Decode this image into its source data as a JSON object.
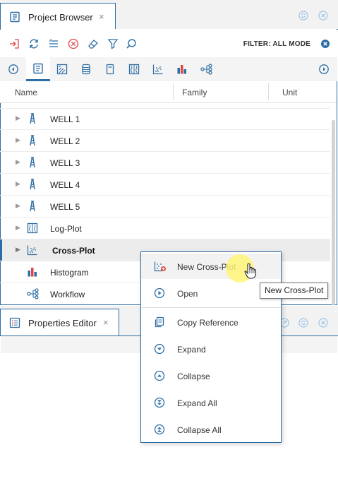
{
  "colors": {
    "accent": "#2d6da3",
    "danger": "#e04646"
  },
  "project_browser": {
    "tab_title": "Project Browser",
    "tab_close": "×",
    "filter_label": "FILTER: ALL MODE",
    "columns": [
      "Name",
      "Family",
      "Unit"
    ],
    "tree_items": [
      {
        "label": "WELL 1",
        "icon": "well-icon"
      },
      {
        "label": "WELL 2",
        "icon": "well-icon"
      },
      {
        "label": "WELL 3",
        "icon": "well-icon"
      },
      {
        "label": "WELL 4",
        "icon": "well-icon"
      },
      {
        "label": "WELL 5",
        "icon": "well-icon"
      },
      {
        "label": "Log-Plot",
        "icon": "log-plot-icon"
      },
      {
        "label": "Cross-Plot",
        "icon": "cross-plot-icon"
      },
      {
        "label": "Histogram",
        "icon": "histogram-icon"
      },
      {
        "label": "Workflow",
        "icon": "workflow-icon"
      }
    ]
  },
  "properties_editor": {
    "tab_title": "Properties Editor",
    "tab_close": "×"
  },
  "context_menu": {
    "items": [
      {
        "label": "New Cross-Plot",
        "icon": "new-cross-plot-icon"
      },
      {
        "label": "Open",
        "icon": "open-icon"
      },
      {
        "label": "Copy Reference",
        "icon": "copy-icon"
      },
      {
        "label": "Expand",
        "icon": "expand-icon"
      },
      {
        "label": "Collapse",
        "icon": "collapse-icon"
      },
      {
        "label": "Expand All",
        "icon": "expand-all-icon"
      },
      {
        "label": "Collapse All",
        "icon": "collapse-all-icon"
      }
    ]
  },
  "tooltip": {
    "text": "New Cross-Plot"
  }
}
